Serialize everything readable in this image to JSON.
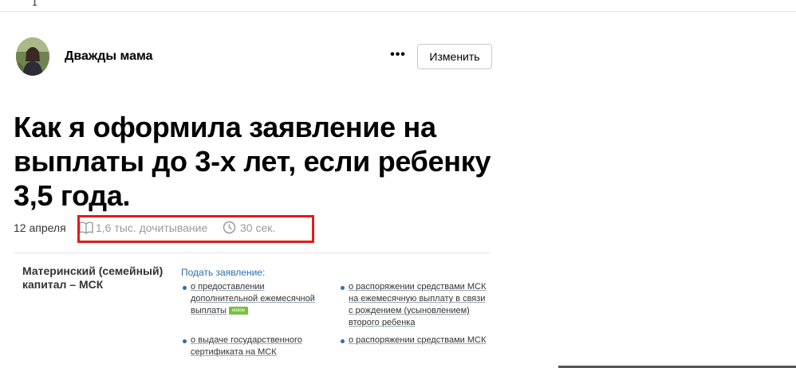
{
  "cursor": {
    "glyph": "I"
  },
  "author": {
    "name": "Дважды мама",
    "more_label": "•••",
    "edit_label": "Изменить"
  },
  "article": {
    "title": "Как я оформила заявление на выплаты до 3-х лет, если ребенку 3,5 года.",
    "date": "12 апреля",
    "reads": "1,6 тыс. дочитывание",
    "read_time": "30 сек."
  },
  "embed": {
    "heading": "Материнский (семейный) капитал – МСК",
    "apply_label": "Подать заявление:",
    "links": [
      {
        "text": "о предоставлении дополнительной ежемесячной выплаты",
        "badge": "новое"
      },
      {
        "text": "о распоряжении средствами МСК на ежемесячную выплату в связи с рождением (усыновлением) второго ребенка"
      },
      {
        "text": "о выдаче государственного сертификата на МСК"
      },
      {
        "text": "о распоряжении средствами МСК"
      }
    ]
  },
  "colors": {
    "highlight": "#e01b1b",
    "link_blue": "#2a6db3",
    "badge_green": "#7ac142"
  }
}
